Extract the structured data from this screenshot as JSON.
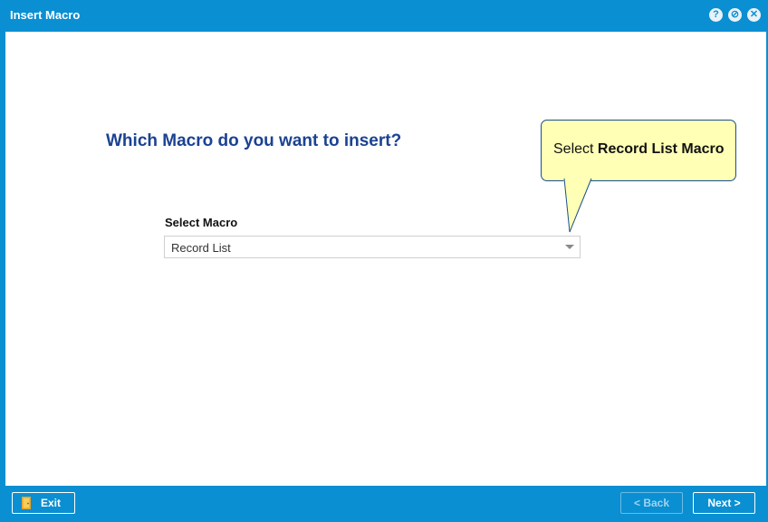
{
  "window": {
    "title": "Insert Macro",
    "controls": [
      "help-icon",
      "minimize-icon",
      "close-icon"
    ],
    "help_glyph": "?",
    "min_glyph": "⊘",
    "close_glyph": "✕"
  },
  "main": {
    "question": "Which Macro do you want to insert?",
    "select_label": "Select Macro",
    "select_value": "Record List"
  },
  "callout": {
    "prefix": "Select ",
    "emphasis": "Record List Macro"
  },
  "footer": {
    "exit_label": "Exit",
    "back_label": "< Back",
    "next_label": "Next >"
  },
  "colors": {
    "chrome_blue": "#0a8fd2",
    "heading_blue": "#1b4292",
    "callout_yellow": "#ffffb5"
  }
}
